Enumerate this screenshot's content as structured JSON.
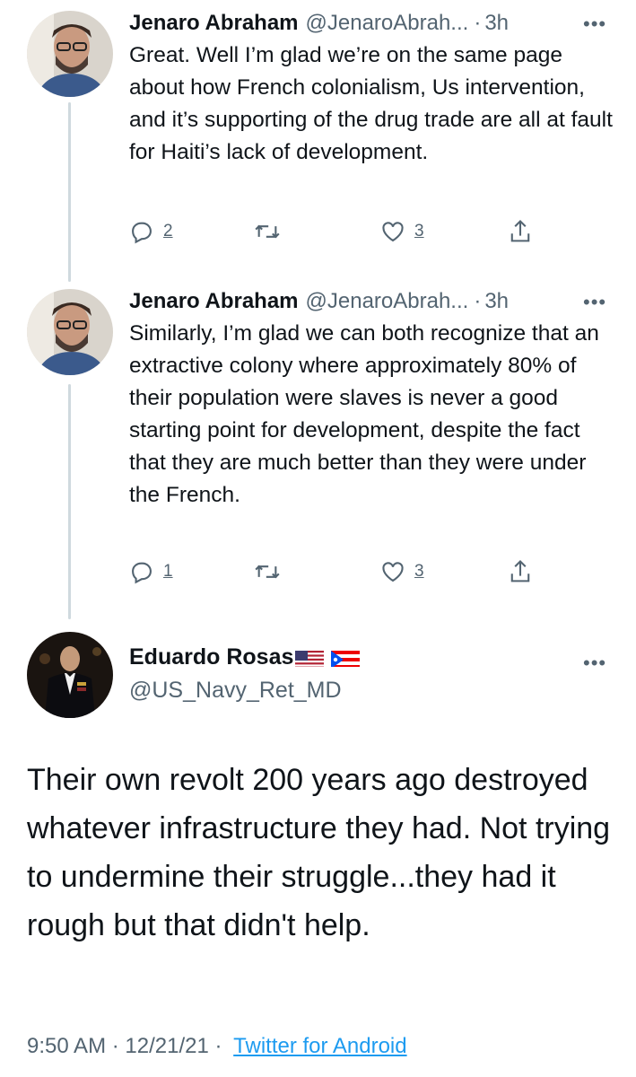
{
  "tweets": [
    {
      "name": "Jenaro Abraham",
      "handle": "@JenaroAbrah...",
      "separator": "·",
      "time": "3h",
      "more": "•••",
      "text": "Great. Well I’m glad we’re on the same page about how French colonialism, Us intervention, and it’s supporting of the drug trade are all at fault for Haiti’s lack of development.",
      "reply_count": "2",
      "retweet_count": "",
      "like_count": "3"
    },
    {
      "name": "Jenaro Abraham",
      "handle": "@JenaroAbrah...",
      "separator": "·",
      "time": "3h",
      "more": "•••",
      "text": "Similarly, I’m glad we can both recognize that an extractive colony where approximately 80% of their population were slaves is never a good starting point for development, despite the fact that they are much better than they were under the French.",
      "reply_count": "1",
      "retweet_count": "",
      "like_count": "3"
    }
  ],
  "main_tweet": {
    "name": "Eduardo Rosas",
    "handle": "@US_Navy_Ret_MD",
    "more": "•••",
    "flags": [
      "us-flag",
      "puerto-rico-flag"
    ],
    "text": "Their own revolt 200 years ago destroyed whatever infrastructure they had. Not trying to undermine their struggle...they had it rough but that didn't help.",
    "time": "9:50 AM",
    "date": "12/21/21",
    "separator": "·",
    "source": "Twitter for Android"
  },
  "colors": {
    "text": "#0f1419",
    "secondary": "#536471",
    "link": "#1d9bf0",
    "thread_line": "#cfd9de"
  },
  "icons": [
    "reply-icon",
    "retweet-icon",
    "like-icon",
    "share-icon",
    "more-icon"
  ]
}
